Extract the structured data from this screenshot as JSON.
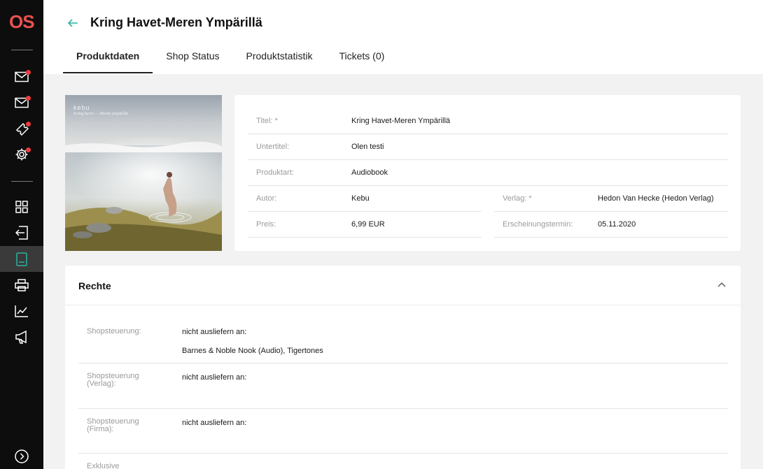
{
  "app": {
    "logo_text": "OS"
  },
  "sidebar": {
    "items": [
      {
        "icon": "mail-icon",
        "badge": true
      },
      {
        "icon": "mail-open-icon",
        "badge": true
      },
      {
        "icon": "ticket-icon",
        "badge": true
      },
      {
        "icon": "gear-icon",
        "badge": true
      },
      {
        "icon": "grid-icon",
        "badge": false
      },
      {
        "icon": "import-icon",
        "badge": false
      },
      {
        "icon": "ebook-icon",
        "badge": false,
        "active": true
      },
      {
        "icon": "printer-icon",
        "badge": false
      },
      {
        "icon": "chart-icon",
        "badge": false
      },
      {
        "icon": "megaphone-icon",
        "badge": false
      }
    ],
    "expand_icon": "chevron-right-circle-icon"
  },
  "header": {
    "title": "Kring Havet-Meren Ympärillä",
    "tabs": [
      {
        "label": "Produktdaten",
        "active": true
      },
      {
        "label": "Shop Status",
        "active": false
      },
      {
        "label": "Produktstatistik",
        "active": false
      },
      {
        "label": "Tickets (0)",
        "active": false
      }
    ]
  },
  "cover": {
    "brand": "kebu",
    "subtitle": "Kring havet — Meren ympärillä"
  },
  "product": {
    "title_label": "Titel: *",
    "title_value": "Kring Havet-Meren Ympärillä",
    "subtitle_label": "Untertitel:",
    "subtitle_value": "Olen testi",
    "type_label": "Produktart:",
    "type_value": "Audiobook",
    "author_label": "Autor:",
    "author_value": "Kebu",
    "publisher_label": "Verlag: *",
    "publisher_value": "Hedon Van Hecke (Hedon Verlag)",
    "price_label": "Preis:",
    "price_value": "6,99 EUR",
    "release_label": "Erscheinungstermin:",
    "release_value": "05.11.2020"
  },
  "rights": {
    "title": "Rechte",
    "rows": [
      {
        "label": "Shopsteuerung:",
        "value": "nicht ausliefern an:",
        "detail": "Barnes & Noble Nook (Audio), Tigertones"
      },
      {
        "label": "Shopsteuerung (Verlag):",
        "value": "nicht ausliefern an:"
      },
      {
        "label": "Shopsteuerung (Firma):",
        "value": "nicht ausliefern an:"
      },
      {
        "label": "Exklusive Shopsteuerung:"
      }
    ]
  },
  "colors": {
    "accent": "#2bb3a0",
    "badge": "#ee3a3a",
    "logo": "#e8524f"
  }
}
